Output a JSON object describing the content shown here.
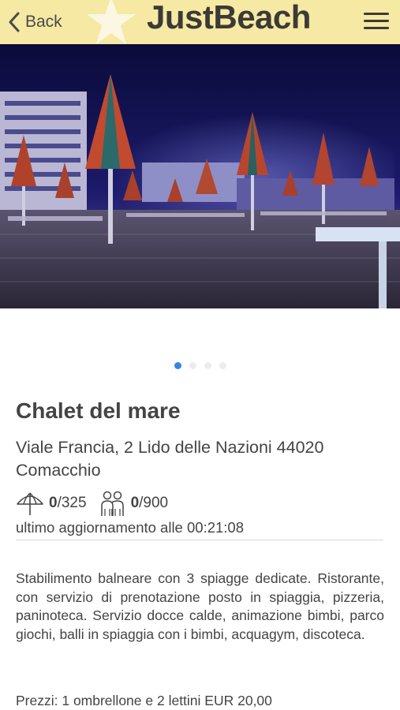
{
  "header": {
    "back_label": "Back",
    "logo_text": "JustBeach",
    "bg_color": "#f5e9a3"
  },
  "hero": {
    "slides_total": 4,
    "active_slide": 1
  },
  "place": {
    "name": "Chalet del mare",
    "address": "Viale Francia, 2 Lido delle Nazioni 44020 Comacchio",
    "umbrellas_used": "0",
    "umbrellas_total": "/325",
    "people_used": "0",
    "people_total": "/900",
    "updated": "ultimo aggiornamento alle 00:21:08",
    "description": "Stabilimento balneare con 3 spiagge dedicate. Ristorante, con servizio di prenotazione posto in spiaggia, pizzeria, paninoteca. Servizio docce calde, animazione bimbi, parco giochi, balli in spiaggia con i bimbi, acquagym, discoteca.",
    "prices": "Prezzi: 1 ombrellone e 2 lettini EUR 20,00"
  },
  "icons": {
    "back": "chevron-left-icon",
    "menu": "hamburger-menu-icon",
    "umbrella": "umbrella-icon",
    "people": "people-icon"
  }
}
